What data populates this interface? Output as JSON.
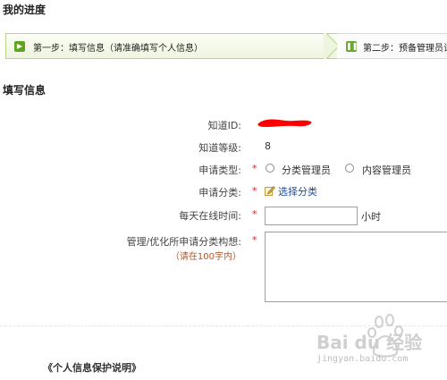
{
  "progress": {
    "title": "我的进度",
    "steps": [
      {
        "label": "第一步：填写信息（请准确填写个人信息）",
        "state": "active"
      },
      {
        "label": "第二步：预备管理员试",
        "state": "pending"
      }
    ]
  },
  "form": {
    "title": "填写信息",
    "fields": {
      "zhidao_id": {
        "label": "知道ID:"
      },
      "level": {
        "label": "知道等级:",
        "value": "8"
      },
      "apply_type": {
        "label": "申请类型:",
        "required": "*",
        "options": [
          "分类管理员",
          "内容管理员"
        ]
      },
      "apply_category": {
        "label": "申请分类:",
        "required": "*",
        "link": "选择分类"
      },
      "daily_online": {
        "label": "每天在线时间:",
        "required": "*",
        "unit": "小时",
        "value": ""
      },
      "plan": {
        "label": "管理/优化所申请分类构想:",
        "required": "*",
        "note": "（请在100字内）",
        "value": ""
      }
    }
  },
  "privacy": {
    "title": "《个人信息保护说明》"
  },
  "watermark": {
    "logo": "Bai du 经验",
    "url": "jingyan.baidu.com"
  },
  "colors": {
    "active_step_border": "#b9d38d",
    "required": "#cc2b2b",
    "link": "#1d4fa0",
    "redaction": "#ff0000"
  }
}
